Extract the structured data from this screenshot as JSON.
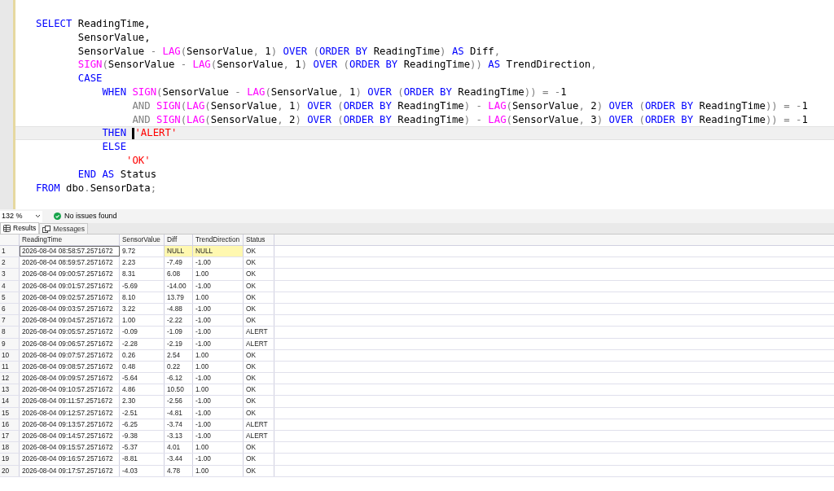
{
  "editor": {
    "lines": [
      {
        "current": false,
        "tokens": [
          {
            "kind": "kw",
            "text": "SELECT"
          },
          {
            "kind": "plain",
            "text": " ReadingTime,"
          }
        ]
      },
      {
        "current": false,
        "tokens": [
          {
            "kind": "plain",
            "text": "       SensorValue,"
          }
        ]
      },
      {
        "current": false,
        "tokens": [
          {
            "kind": "plain",
            "text": "       SensorValue"
          },
          {
            "kind": "op",
            "text": " -"
          },
          {
            "kind": "fn",
            "text": " LAG"
          },
          {
            "kind": "op",
            "text": "("
          },
          {
            "kind": "plain",
            "text": "SensorValue"
          },
          {
            "kind": "op",
            "text": ","
          },
          {
            "kind": "plain",
            "text": " 1"
          },
          {
            "kind": "op",
            "text": ")"
          },
          {
            "kind": "kw",
            "text": " OVER"
          },
          {
            "kind": "op",
            "text": " ("
          },
          {
            "kind": "kw",
            "text": "ORDER BY"
          },
          {
            "kind": "plain",
            "text": " ReadingTime"
          },
          {
            "kind": "op",
            "text": ")"
          },
          {
            "kind": "kw",
            "text": " AS"
          },
          {
            "kind": "plain",
            "text": " Diff"
          },
          {
            "kind": "op",
            "text": ","
          }
        ]
      },
      {
        "current": false,
        "tokens": [
          {
            "kind": "fn",
            "text": "       SIGN"
          },
          {
            "kind": "op",
            "text": "("
          },
          {
            "kind": "plain",
            "text": "SensorValue"
          },
          {
            "kind": "op",
            "text": " -"
          },
          {
            "kind": "fn",
            "text": " LAG"
          },
          {
            "kind": "op",
            "text": "("
          },
          {
            "kind": "plain",
            "text": "SensorValue"
          },
          {
            "kind": "op",
            "text": ","
          },
          {
            "kind": "plain",
            "text": " 1"
          },
          {
            "kind": "op",
            "text": ")"
          },
          {
            "kind": "kw",
            "text": " OVER"
          },
          {
            "kind": "op",
            "text": " ("
          },
          {
            "kind": "kw",
            "text": "ORDER BY"
          },
          {
            "kind": "plain",
            "text": " ReadingTime"
          },
          {
            "kind": "op",
            "text": "))"
          },
          {
            "kind": "kw",
            "text": " AS"
          },
          {
            "kind": "plain",
            "text": " TrendDirection"
          },
          {
            "kind": "op",
            "text": ","
          }
        ]
      },
      {
        "current": false,
        "tokens": [
          {
            "kind": "kw",
            "text": "       CASE"
          }
        ]
      },
      {
        "current": false,
        "tokens": [
          {
            "kind": "kw",
            "text": "           WHEN"
          },
          {
            "kind": "fn",
            "text": " SIGN"
          },
          {
            "kind": "op",
            "text": "("
          },
          {
            "kind": "plain",
            "text": "SensorValue"
          },
          {
            "kind": "op",
            "text": " -"
          },
          {
            "kind": "fn",
            "text": " LAG"
          },
          {
            "kind": "op",
            "text": "("
          },
          {
            "kind": "plain",
            "text": "SensorValue"
          },
          {
            "kind": "op",
            "text": ","
          },
          {
            "kind": "plain",
            "text": " 1"
          },
          {
            "kind": "op",
            "text": ")"
          },
          {
            "kind": "kw",
            "text": " OVER"
          },
          {
            "kind": "op",
            "text": " ("
          },
          {
            "kind": "kw",
            "text": "ORDER BY"
          },
          {
            "kind": "plain",
            "text": " ReadingTime"
          },
          {
            "kind": "op",
            "text": "))"
          },
          {
            "kind": "op",
            "text": " = -"
          },
          {
            "kind": "plain",
            "text": "1"
          }
        ]
      },
      {
        "current": false,
        "tokens": [
          {
            "kind": "op",
            "text": "                AND"
          },
          {
            "kind": "fn",
            "text": " SIGN"
          },
          {
            "kind": "op",
            "text": "("
          },
          {
            "kind": "fn",
            "text": "LAG"
          },
          {
            "kind": "op",
            "text": "("
          },
          {
            "kind": "plain",
            "text": "SensorValue"
          },
          {
            "kind": "op",
            "text": ","
          },
          {
            "kind": "plain",
            "text": " 1"
          },
          {
            "kind": "op",
            "text": ")"
          },
          {
            "kind": "kw",
            "text": " OVER"
          },
          {
            "kind": "op",
            "text": " ("
          },
          {
            "kind": "kw",
            "text": "ORDER BY"
          },
          {
            "kind": "plain",
            "text": " ReadingTime"
          },
          {
            "kind": "op",
            "text": ") -"
          },
          {
            "kind": "fn",
            "text": " LAG"
          },
          {
            "kind": "op",
            "text": "("
          },
          {
            "kind": "plain",
            "text": "SensorValue"
          },
          {
            "kind": "op",
            "text": ","
          },
          {
            "kind": "plain",
            "text": " 2"
          },
          {
            "kind": "op",
            "text": ")"
          },
          {
            "kind": "kw",
            "text": " OVER"
          },
          {
            "kind": "op",
            "text": " ("
          },
          {
            "kind": "kw",
            "text": "ORDER BY"
          },
          {
            "kind": "plain",
            "text": " ReadingTime"
          },
          {
            "kind": "op",
            "text": ")) = -"
          },
          {
            "kind": "plain",
            "text": "1"
          }
        ]
      },
      {
        "current": false,
        "tokens": [
          {
            "kind": "op",
            "text": "                AND"
          },
          {
            "kind": "fn",
            "text": " SIGN"
          },
          {
            "kind": "op",
            "text": "("
          },
          {
            "kind": "fn",
            "text": "LAG"
          },
          {
            "kind": "op",
            "text": "("
          },
          {
            "kind": "plain",
            "text": "SensorValue"
          },
          {
            "kind": "op",
            "text": ","
          },
          {
            "kind": "plain",
            "text": " 2"
          },
          {
            "kind": "op",
            "text": ")"
          },
          {
            "kind": "kw",
            "text": " OVER"
          },
          {
            "kind": "op",
            "text": " ("
          },
          {
            "kind": "kw",
            "text": "ORDER BY"
          },
          {
            "kind": "plain",
            "text": " ReadingTime"
          },
          {
            "kind": "op",
            "text": ") -"
          },
          {
            "kind": "fn",
            "text": " LAG"
          },
          {
            "kind": "op",
            "text": "("
          },
          {
            "kind": "plain",
            "text": "SensorValue"
          },
          {
            "kind": "op",
            "text": ","
          },
          {
            "kind": "plain",
            "text": " 3"
          },
          {
            "kind": "op",
            "text": ")"
          },
          {
            "kind": "kw",
            "text": " OVER"
          },
          {
            "kind": "op",
            "text": " ("
          },
          {
            "kind": "kw",
            "text": "ORDER BY"
          },
          {
            "kind": "plain",
            "text": " ReadingTime"
          },
          {
            "kind": "op",
            "text": ")) = -"
          },
          {
            "kind": "plain",
            "text": "1"
          }
        ]
      },
      {
        "current": true,
        "tokens": [
          {
            "kind": "kw",
            "text": "           THEN "
          },
          {
            "kind": "str",
            "text": "'ALERT'"
          }
        ]
      },
      {
        "current": false,
        "tokens": [
          {
            "kind": "kw",
            "text": "           ELSE"
          }
        ]
      },
      {
        "current": false,
        "tokens": [
          {
            "kind": "str",
            "text": "               'OK'"
          }
        ]
      },
      {
        "current": false,
        "tokens": [
          {
            "kind": "kw",
            "text": "       END AS"
          },
          {
            "kind": "plain",
            "text": " Status"
          }
        ]
      },
      {
        "current": false,
        "tokens": [
          {
            "kind": "kw",
            "text": "FROM"
          },
          {
            "kind": "plain",
            "text": " dbo"
          },
          {
            "kind": "op",
            "text": "."
          },
          {
            "kind": "plain",
            "text": "SensorData"
          },
          {
            "kind": "op",
            "text": ";"
          }
        ]
      }
    ]
  },
  "status": {
    "zoom": "132 %",
    "message": "No issues found"
  },
  "tabs": [
    {
      "label": "Results",
      "selected": true
    },
    {
      "label": "Messages",
      "selected": false
    }
  ],
  "table": {
    "columns": [
      "ReadingTime",
      "SensorValue",
      "Diff",
      "TrendDirection",
      "Status"
    ],
    "rows": [
      {
        "number": "1",
        "cells": [
          "2026-08-04 08:58:57.2571672",
          "9.72",
          "NULL",
          "NULL",
          "OK"
        ],
        "focused": true,
        "nulls": true
      },
      {
        "number": "2",
        "cells": [
          "2026-08-04 08:59:57.2571672",
          "2.23",
          "-7.49",
          "-1.00",
          "OK"
        ],
        "focused": false,
        "nulls": false
      },
      {
        "number": "3",
        "cells": [
          "2026-08-04 09:00:57.2571672",
          "8.31",
          "6.08",
          "1.00",
          "OK"
        ],
        "focused": false,
        "nulls": false
      },
      {
        "number": "4",
        "cells": [
          "2026-08-04 09:01:57.2571672",
          "-5.69",
          "-14.00",
          "-1.00",
          "OK"
        ],
        "focused": false,
        "nulls": false
      },
      {
        "number": "5",
        "cells": [
          "2026-08-04 09:02:57.2571672",
          "8.10",
          "13.79",
          "1.00",
          "OK"
        ],
        "focused": false,
        "nulls": false
      },
      {
        "number": "6",
        "cells": [
          "2026-08-04 09:03:57.2571672",
          "3.22",
          "-4.88",
          "-1.00",
          "OK"
        ],
        "focused": false,
        "nulls": false
      },
      {
        "number": "7",
        "cells": [
          "2026-08-04 09:04:57.2571672",
          "1.00",
          "-2.22",
          "-1.00",
          "OK"
        ],
        "focused": false,
        "nulls": false
      },
      {
        "number": "8",
        "cells": [
          "2026-08-04 09:05:57.2571672",
          "-0.09",
          "-1.09",
          "-1.00",
          "ALERT"
        ],
        "focused": false,
        "nulls": false
      },
      {
        "number": "9",
        "cells": [
          "2026-08-04 09:06:57.2571672",
          "-2.28",
          "-2.19",
          "-1.00",
          "ALERT"
        ],
        "focused": false,
        "nulls": false
      },
      {
        "number": "10",
        "cells": [
          "2026-08-04 09:07:57.2571672",
          "0.26",
          "2.54",
          "1.00",
          "OK"
        ],
        "focused": false,
        "nulls": false
      },
      {
        "number": "11",
        "cells": [
          "2026-08-04 09:08:57.2571672",
          "0.48",
          "0.22",
          "1.00",
          "OK"
        ],
        "focused": false,
        "nulls": false
      },
      {
        "number": "12",
        "cells": [
          "2026-08-04 09:09:57.2571672",
          "-5.64",
          "-6.12",
          "-1.00",
          "OK"
        ],
        "focused": false,
        "nulls": false
      },
      {
        "number": "13",
        "cells": [
          "2026-08-04 09:10:57.2571672",
          "4.86",
          "10.50",
          "1.00",
          "OK"
        ],
        "focused": false,
        "nulls": false
      },
      {
        "number": "14",
        "cells": [
          "2026-08-04 09:11:57.2571672",
          "2.30",
          "-2.56",
          "-1.00",
          "OK"
        ],
        "focused": false,
        "nulls": false
      },
      {
        "number": "15",
        "cells": [
          "2026-08-04 09:12:57.2571672",
          "-2.51",
          "-4.81",
          "-1.00",
          "OK"
        ],
        "focused": false,
        "nulls": false
      },
      {
        "number": "16",
        "cells": [
          "2026-08-04 09:13:57.2571672",
          "-6.25",
          "-3.74",
          "-1.00",
          "ALERT"
        ],
        "focused": false,
        "nulls": false
      },
      {
        "number": "17",
        "cells": [
          "2026-08-04 09:14:57.2571672",
          "-9.38",
          "-3.13",
          "-1.00",
          "ALERT"
        ],
        "focused": false,
        "nulls": false
      },
      {
        "number": "18",
        "cells": [
          "2026-08-04 09:15:57.2571672",
          "-5.37",
          "4.01",
          "1.00",
          "OK"
        ],
        "focused": false,
        "nulls": false
      },
      {
        "number": "19",
        "cells": [
          "2026-08-04 09:16:57.2571672",
          "-8.81",
          "-3.44",
          "-1.00",
          "OK"
        ],
        "focused": false,
        "nulls": false
      },
      {
        "number": "20",
        "cells": [
          "2026-08-04 09:17:57.2571672",
          "-4.03",
          "4.78",
          "1.00",
          "OK"
        ],
        "focused": false,
        "nulls": false
      }
    ]
  }
}
